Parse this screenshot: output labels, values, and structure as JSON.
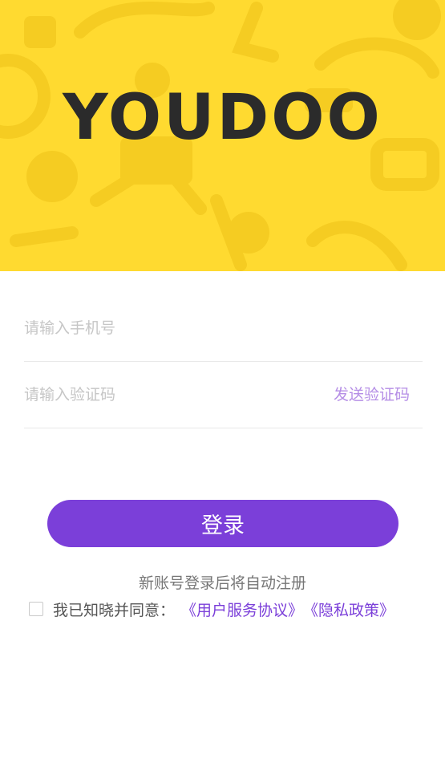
{
  "brand": {
    "logo_text": "YOUDOO"
  },
  "form": {
    "phone_placeholder": "请输入手机号",
    "code_placeholder": "请输入验证码",
    "send_code_label": "发送验证码"
  },
  "login_button_label": "登录",
  "notice": "新账号登录后将自动注册",
  "agreement": {
    "checked": false,
    "prefix": "我已知晓并同意：",
    "user_agreement": "《用户服务协议》",
    "privacy_policy": "《隐私政策》"
  },
  "colors": {
    "hero_background": "#FFDA30",
    "accent": "#7B3FD9",
    "send_code": "#b58ee6"
  }
}
